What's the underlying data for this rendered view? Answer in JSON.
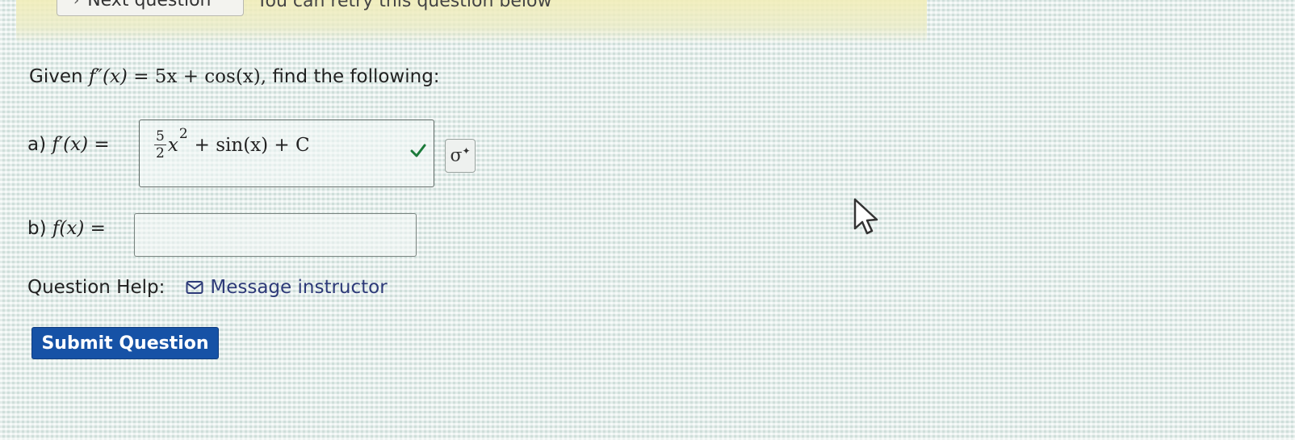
{
  "top_bar": {
    "next_question_label": "Next question",
    "retry_text": "You can retry this question below"
  },
  "question": {
    "given_prefix": "Given",
    "given_lhs": "f″(x)",
    "given_eq": "= 5x + cos(x),",
    "given_suffix": "find the following:"
  },
  "part_a": {
    "label": "a)",
    "lhs": "f′(x) =",
    "answer": {
      "frac_num": "5",
      "frac_den": "2",
      "var": "x",
      "exp": "2",
      "rest": "+ sin(x) + C"
    },
    "status": "correct"
  },
  "part_b": {
    "label": "b)",
    "lhs": "f(x) =",
    "value": ""
  },
  "help": {
    "label": "Question Help:",
    "link_label": "Message instructor"
  },
  "submit": {
    "label": "Submit Question"
  },
  "colors": {
    "submit_bg": "#1652a6",
    "link": "#2d3a78",
    "check": "#1b7a3a"
  }
}
